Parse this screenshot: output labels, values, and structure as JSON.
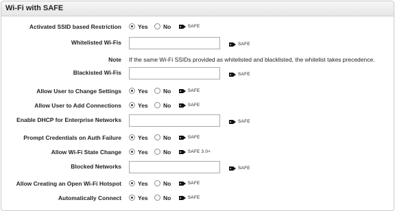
{
  "panel": {
    "title": "Wi-Fi with SAFE"
  },
  "safe_label": "SAFE",
  "rows": {
    "activated_ssid": {
      "label": "Activated SSID based Restriction",
      "yes": "Yes",
      "no": "No",
      "selected": "Yes",
      "tag": "SAFE"
    },
    "whitelisted": {
      "label": "Whitelisted Wi-Fis",
      "value": "",
      "tag": "SAFE"
    },
    "note": {
      "label": "Note",
      "text": "If the same Wi-Fi SSIDs provided as whitelisted and blacklisted, the whitelist takes precedence."
    },
    "blacklisted": {
      "label": "Blackisted Wi-Fis",
      "value": "",
      "tag": "SAFE"
    },
    "allow_change": {
      "label": "Allow User to Change Settings",
      "yes": "Yes",
      "no": "No",
      "selected": "Yes",
      "tag": "SAFE"
    },
    "allow_add": {
      "label": "Allow User to Add Connections",
      "yes": "Yes",
      "no": "No",
      "selected": "Yes",
      "tag": "SAFE"
    },
    "dhcp": {
      "label": "Enable DHCP for Enterprise Networks",
      "value": "",
      "tag": "SAFE"
    },
    "prompt_creds": {
      "label": "Prompt Credentials on Auth Failure",
      "yes": "Yes",
      "no": "No",
      "selected": "Yes",
      "tag": "SAFE"
    },
    "wifi_state": {
      "label": "Allow Wi-Fi State Change",
      "yes": "Yes",
      "no": "No",
      "selected": "Yes",
      "tag": "SAFE 3.0+"
    },
    "blocked": {
      "label": "Blocked Networks",
      "value": "",
      "tag": "SAFE"
    },
    "open_hotspot": {
      "label": "Allow Creating an Open Wi-Fi Hotspot",
      "yes": "Yes",
      "no": "No",
      "selected": "Yes",
      "tag": "SAFE"
    },
    "auto_connect": {
      "label": "Automatically Connect",
      "yes": "Yes",
      "no": "No",
      "selected": "Yes",
      "tag": "SAFE"
    }
  }
}
